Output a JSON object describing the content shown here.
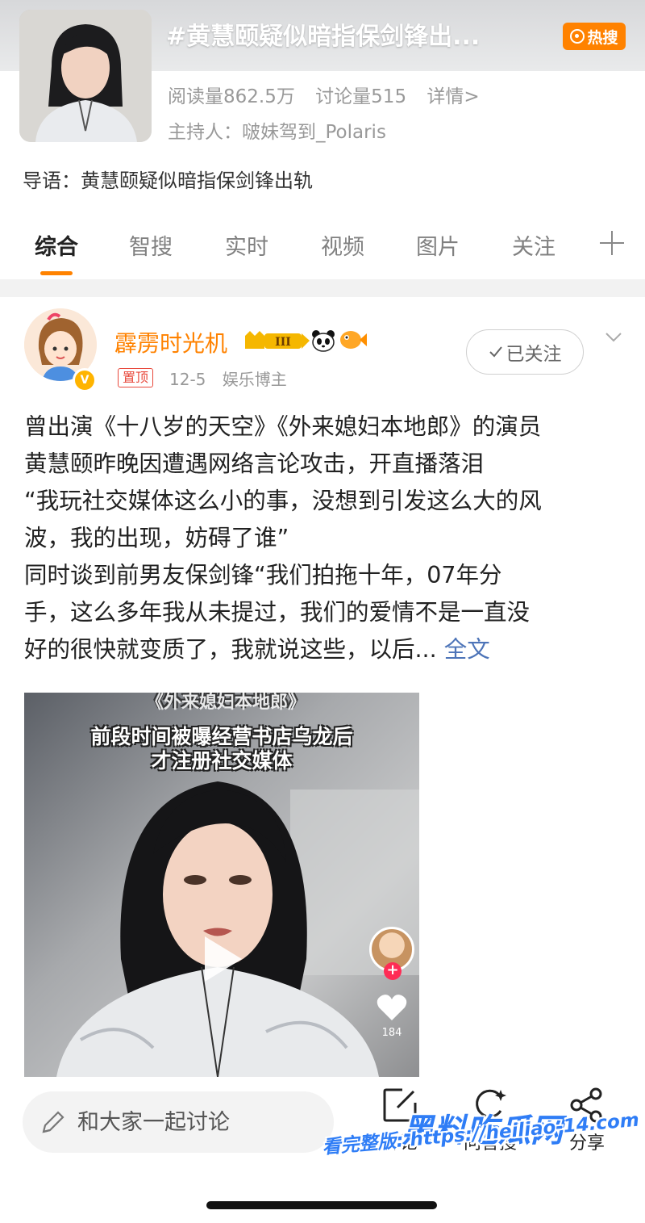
{
  "topic": {
    "title": "#黄慧颐疑似暗指保剑锋出...",
    "hot_badge": "热搜",
    "reads": "阅读量862.5万",
    "discussions": "讨论量515",
    "details": "详情>",
    "host": "主持人：啵妹驾到_Polaris",
    "lead": "导语：黄慧颐疑似暗指保剑锋出轨"
  },
  "tabs": [
    {
      "label": "综合",
      "active": true
    },
    {
      "label": "智搜",
      "active": false
    },
    {
      "label": "实时",
      "active": false
    },
    {
      "label": "视频",
      "active": false
    },
    {
      "label": "图片",
      "active": false
    },
    {
      "label": "关注",
      "active": false
    }
  ],
  "post": {
    "author": "霹雳时光机",
    "vip_level": "III",
    "pin_tag": "置顶",
    "date": "12-5",
    "author_tag": "娱乐博主",
    "follow_label": "已关注",
    "lines": [
      "曾出演《十八岁的天空》《外来媳妇本地郎》的演员",
      "黄慧颐昨晚因遭遇网络言论攻击，开直播落泪",
      "“我玩社交媒体这么小的事，没想到引发这么大的风",
      "波，我的出现，妨碍了谁”",
      "同时谈到前男友保剑锋“我们拍拖十年，07年分",
      "手，这么多年我从未提过，我们的爱情不是一直没",
      "好的很快就变质了，我就说这些，以后..."
    ],
    "full_text_link": "全文"
  },
  "video": {
    "caption_top": "《外来媳妇本地郎》",
    "caption_line1": "前段时间被曝经营书店乌龙后",
    "caption_line2": "才注册社交媒体",
    "like_count": "184"
  },
  "bottom": {
    "comment_placeholder": "和大家一起讨论",
    "action_discuss": "讨论",
    "action_ask": "问智搜",
    "action_share": "分享"
  },
  "watermark": {
    "logo": "黑料吃瓜网",
    "url": "看完整版: https://heiliao-14.com"
  },
  "colors": {
    "accent": "#ff8200",
    "link": "#4d74b8",
    "pin_red": "#e8483b"
  }
}
